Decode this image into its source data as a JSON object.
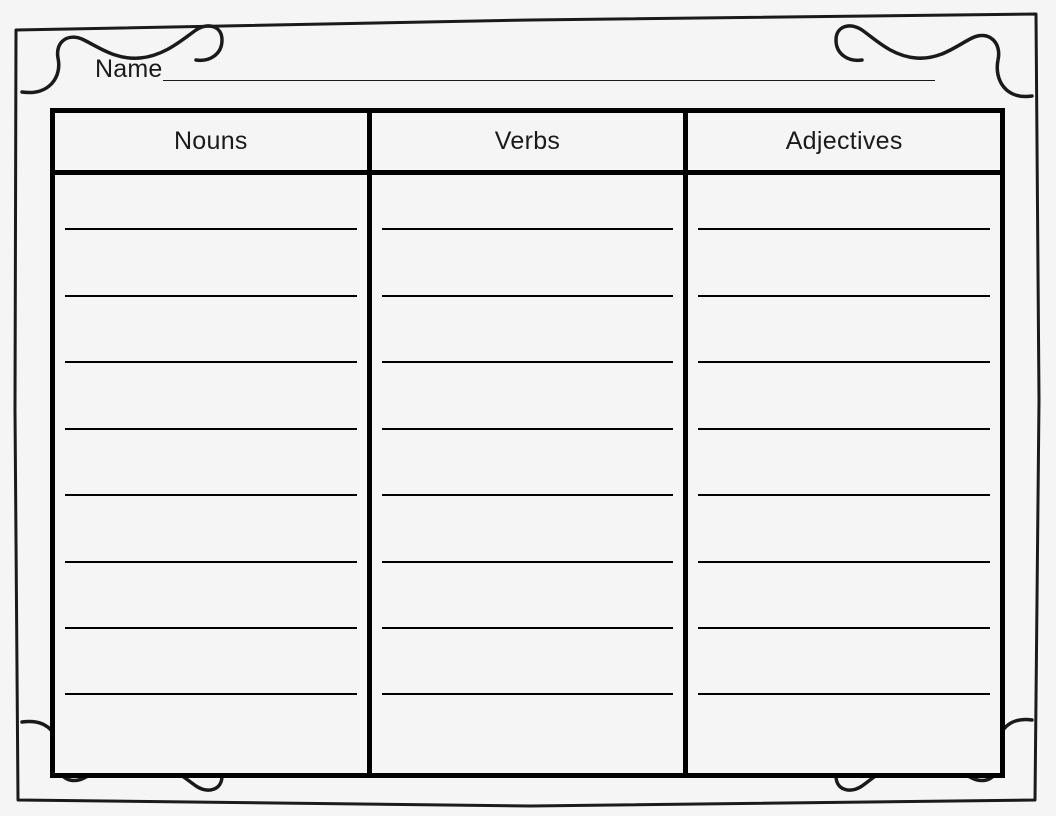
{
  "worksheet": {
    "name_field": {
      "label": "Name",
      "value": "",
      "placeholder": ""
    },
    "frame": {
      "style": "hand-drawn-doodle-border",
      "corner_decoration": "squiggle-corner"
    },
    "table": {
      "columns": [
        {
          "header": "Nouns",
          "lines": 8,
          "entries": [
            "",
            "",
            "",
            "",
            "",
            "",
            "",
            ""
          ]
        },
        {
          "header": "Verbs",
          "lines": 8,
          "entries": [
            "",
            "",
            "",
            "",
            "",
            "",
            "",
            ""
          ]
        },
        {
          "header": "Adjectives",
          "lines": 8,
          "entries": [
            "",
            "",
            "",
            "",
            "",
            "",
            "",
            ""
          ]
        }
      ],
      "line_count": 8
    },
    "colors": {
      "page_background": "#f5f5f5",
      "ink": "#1a1a1a",
      "border": "#000000"
    }
  }
}
